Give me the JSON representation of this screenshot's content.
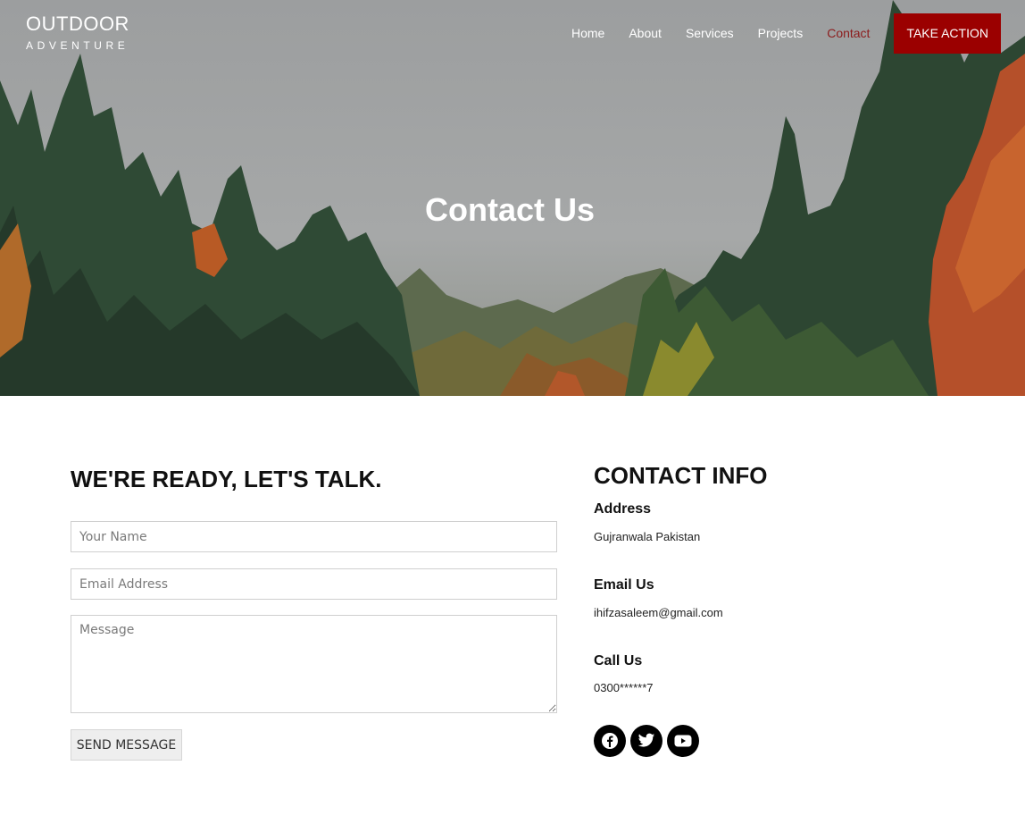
{
  "brand": {
    "title": "OUTDOOR",
    "subtitle": "ADVENTURE"
  },
  "nav": {
    "items": [
      {
        "label": "Home"
      },
      {
        "label": "About"
      },
      {
        "label": "Services"
      },
      {
        "label": "Projects"
      },
      {
        "label": "Contact"
      }
    ],
    "active": "Contact",
    "cta_label": "TAKE ACTION"
  },
  "hero": {
    "title": "Contact Us"
  },
  "form": {
    "heading": "WE'RE READY, LET'S TALK.",
    "name_placeholder": "Your Name",
    "email_placeholder": "Email Address",
    "message_placeholder": "Message",
    "submit_label": "SEND MESSAGE"
  },
  "contact_info": {
    "title": "CONTACT INFO",
    "address_label": "Address",
    "address_value": "Gujranwala Pakistan",
    "email_label": "Email Us",
    "email_value": "ihifzasaleem@gmail.com",
    "phone_label": "Call Us",
    "phone_value": "0300******7"
  },
  "socials": [
    "facebook-icon",
    "twitter-icon",
    "youtube-icon"
  ],
  "colors": {
    "accent": "#9b0000",
    "active_nav": "#8c1c1c",
    "text": "#111111"
  }
}
